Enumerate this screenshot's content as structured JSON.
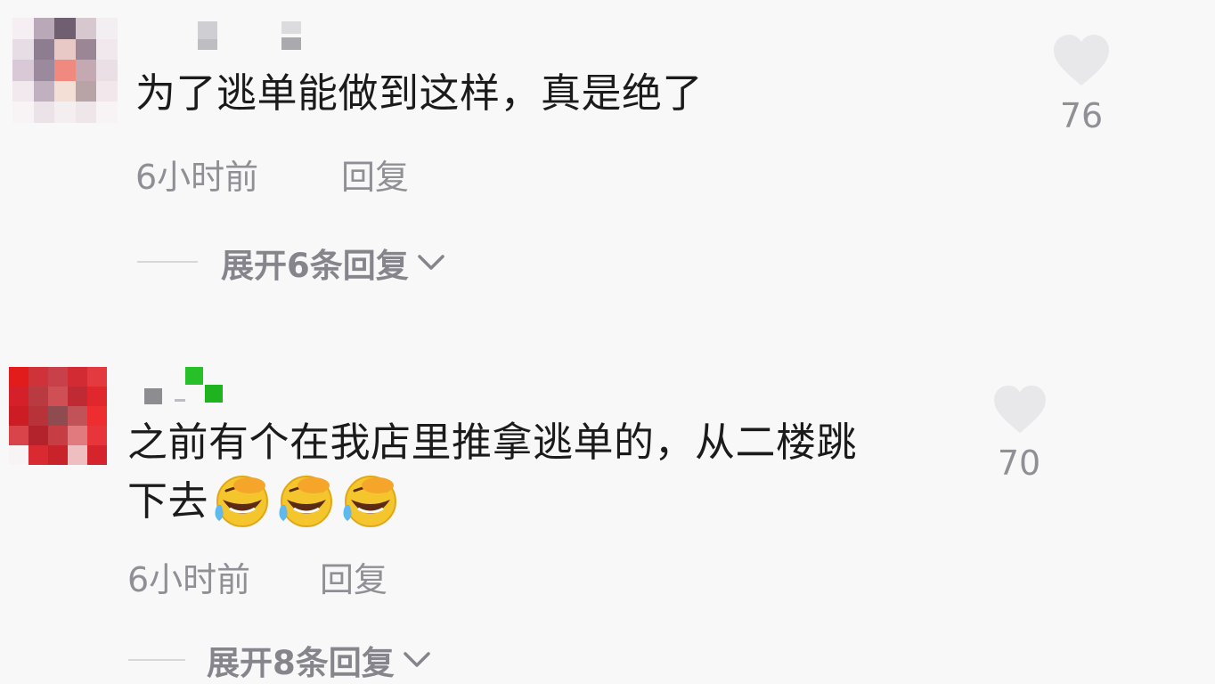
{
  "comments": [
    {
      "text": "为了逃单能做到这样，真是绝了",
      "time": "6小时前",
      "reply": "回复",
      "likes": "76",
      "expand": "展开6条回复"
    },
    {
      "text_line1": "之前有个在我店里推拿逃单的，从二楼跳",
      "text_line2": "下去",
      "emojis": [
        "laughing-crying-emoji",
        "laughing-crying-emoji",
        "laughing-crying-emoji"
      ],
      "time": "6小时前",
      "reply": "回复",
      "likes": "70",
      "expand": "展开8条回复"
    }
  ],
  "icons": {
    "like": "heart-icon",
    "expand": "chevron-down-icon"
  },
  "colors": {
    "background": "#f8f8f9",
    "text": "#1b1b1b",
    "meta": "#8f8f95",
    "heart": "#e8e8ea"
  }
}
